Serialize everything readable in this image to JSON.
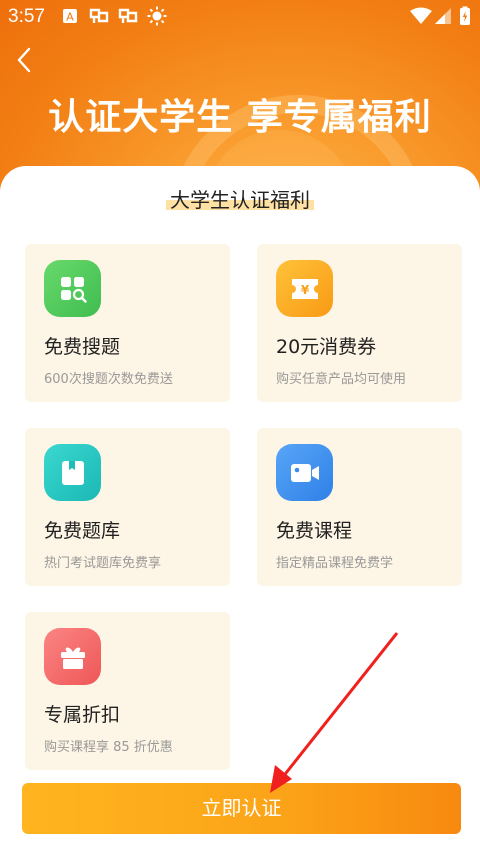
{
  "status_bar": {
    "time": "3:57"
  },
  "header": {
    "title": "认证大学生 享专属福利"
  },
  "section": {
    "title": "大学生认证福利"
  },
  "benefits": [
    {
      "name": "免费搜题",
      "desc": "600次搜题次数免费送",
      "icon": "search-grid-icon",
      "color": "#4fc95a"
    },
    {
      "name": "20元消费券",
      "desc": "购买任意产品均可使用",
      "icon": "coupon-icon",
      "color": "#fba51c"
    },
    {
      "name": "免费题库",
      "desc": "热门考试题库免费享",
      "icon": "bookmark-icon",
      "color": "#27c7c0"
    },
    {
      "name": "免费课程",
      "desc": "指定精品课程免费学",
      "icon": "video-camera-icon",
      "color": "#3d8ef0"
    },
    {
      "name": "专属折扣",
      "desc": "购买课程享 85 折优惠",
      "icon": "gift-icon",
      "color": "#f16766"
    }
  ],
  "cta": {
    "label": "立即认证"
  }
}
